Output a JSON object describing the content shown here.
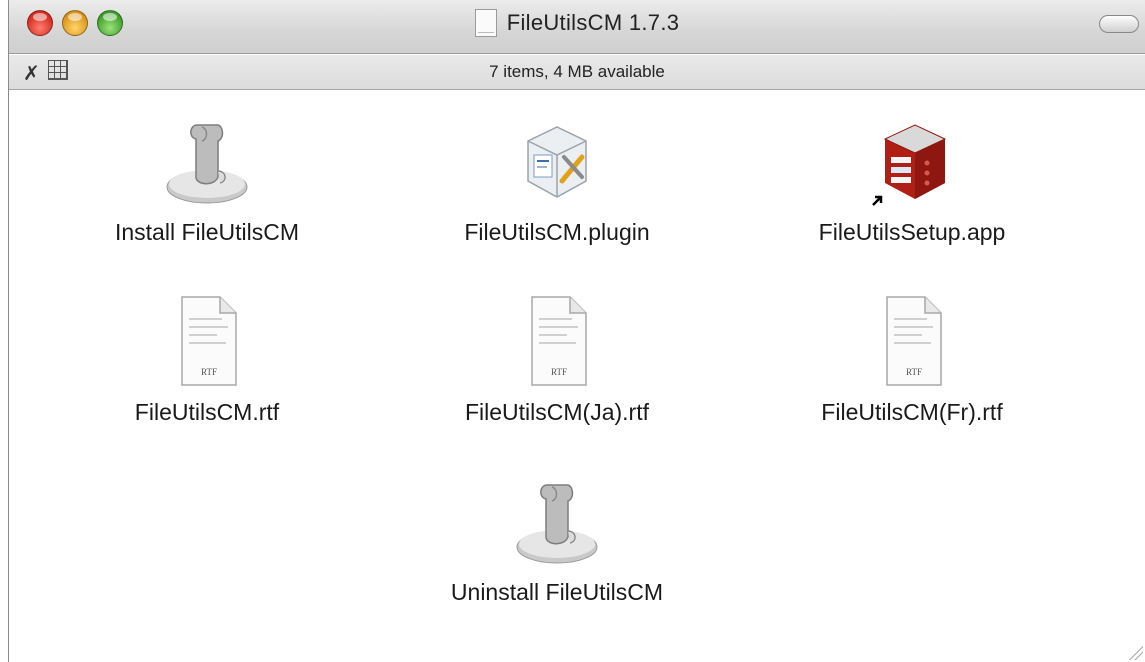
{
  "window": {
    "title": "FileUtilsCM 1.7.3",
    "status": "7 items, 4 MB available"
  },
  "icons_meta": {
    "installer": "installer-script-icon",
    "plugin": "plugin-bundle-icon",
    "app": "red-app-box-icon",
    "rtf": "rtf-document-icon"
  },
  "items": [
    {
      "label": "Install FileUtilsCM",
      "icon": "installer-script-icon"
    },
    {
      "label": "FileUtilsCM.plugin",
      "icon": "plugin-bundle-icon"
    },
    {
      "label": "FileUtilsSetup.app",
      "icon": "red-app-box-icon"
    },
    {
      "label": "FileUtilsCM.rtf",
      "icon": "rtf-document-icon",
      "badge": "RTF"
    },
    {
      "label": "FileUtilsCM(Ja).rtf",
      "icon": "rtf-document-icon",
      "badge": "RTF"
    },
    {
      "label": "FileUtilsCM(Fr).rtf",
      "icon": "rtf-document-icon",
      "badge": "RTF"
    },
    {
      "label": "Uninstall FileUtilsCM",
      "icon": "installer-script-icon"
    }
  ],
  "colors": {
    "app_red": "#c0261c",
    "selection": "#3875d7"
  }
}
